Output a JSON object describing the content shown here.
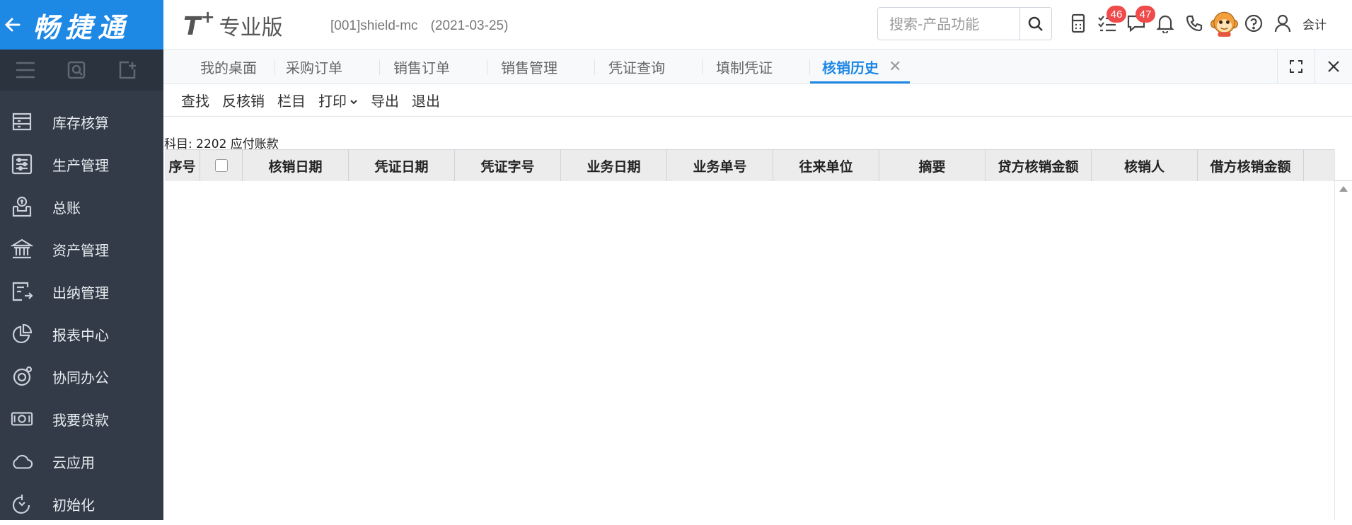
{
  "brand": {
    "name": "畅捷通"
  },
  "sidebar": {
    "items": [
      {
        "label": "库存核算",
        "icon": "inventory-icon"
      },
      {
        "label": "生产管理",
        "icon": "production-icon"
      },
      {
        "label": "总账",
        "icon": "ledger-icon"
      },
      {
        "label": "资产管理",
        "icon": "bank-icon"
      },
      {
        "label": "出纳管理",
        "icon": "cashier-icon"
      },
      {
        "label": "报表中心",
        "icon": "pie-chart-icon"
      },
      {
        "label": "协同办公",
        "icon": "collab-icon"
      },
      {
        "label": "我要贷款",
        "icon": "cash-icon"
      },
      {
        "label": "云应用",
        "icon": "cloud-icon"
      },
      {
        "label": "初始化",
        "icon": "refresh-icon"
      }
    ]
  },
  "header": {
    "product": "T",
    "product_sup": "+",
    "edition": "专业版",
    "account": "[001]shield-mc",
    "date": "(2021-03-25)",
    "search_placeholder": "搜索-产品功能",
    "badges": {
      "tasks": "46",
      "messages": "47"
    },
    "role": "会计"
  },
  "tabs": [
    {
      "label": "我的桌面"
    },
    {
      "label": "采购订单"
    },
    {
      "label": "销售订单"
    },
    {
      "label": "销售管理"
    },
    {
      "label": "凭证查询"
    },
    {
      "label": "填制凭证"
    },
    {
      "label": "核销历史",
      "active": true
    }
  ],
  "toolbar": {
    "find": "查找",
    "unverify": "反核销",
    "columns": "栏目",
    "print": "打印",
    "export": "导出",
    "exit": "退出"
  },
  "subject_label": "科目: 2202 应付账款",
  "grid": {
    "columns": [
      "序号",
      "",
      "核销日期",
      "凭证日期",
      "凭证字号",
      "业务日期",
      "业务单号",
      "往来单位",
      "摘要",
      "贷方核销金额",
      "核销人",
      "借方核销金额",
      ""
    ],
    "rows": []
  },
  "colors": {
    "accent": "#1e88e5",
    "sidebar": "#323b47",
    "badge": "#f04b4b"
  }
}
